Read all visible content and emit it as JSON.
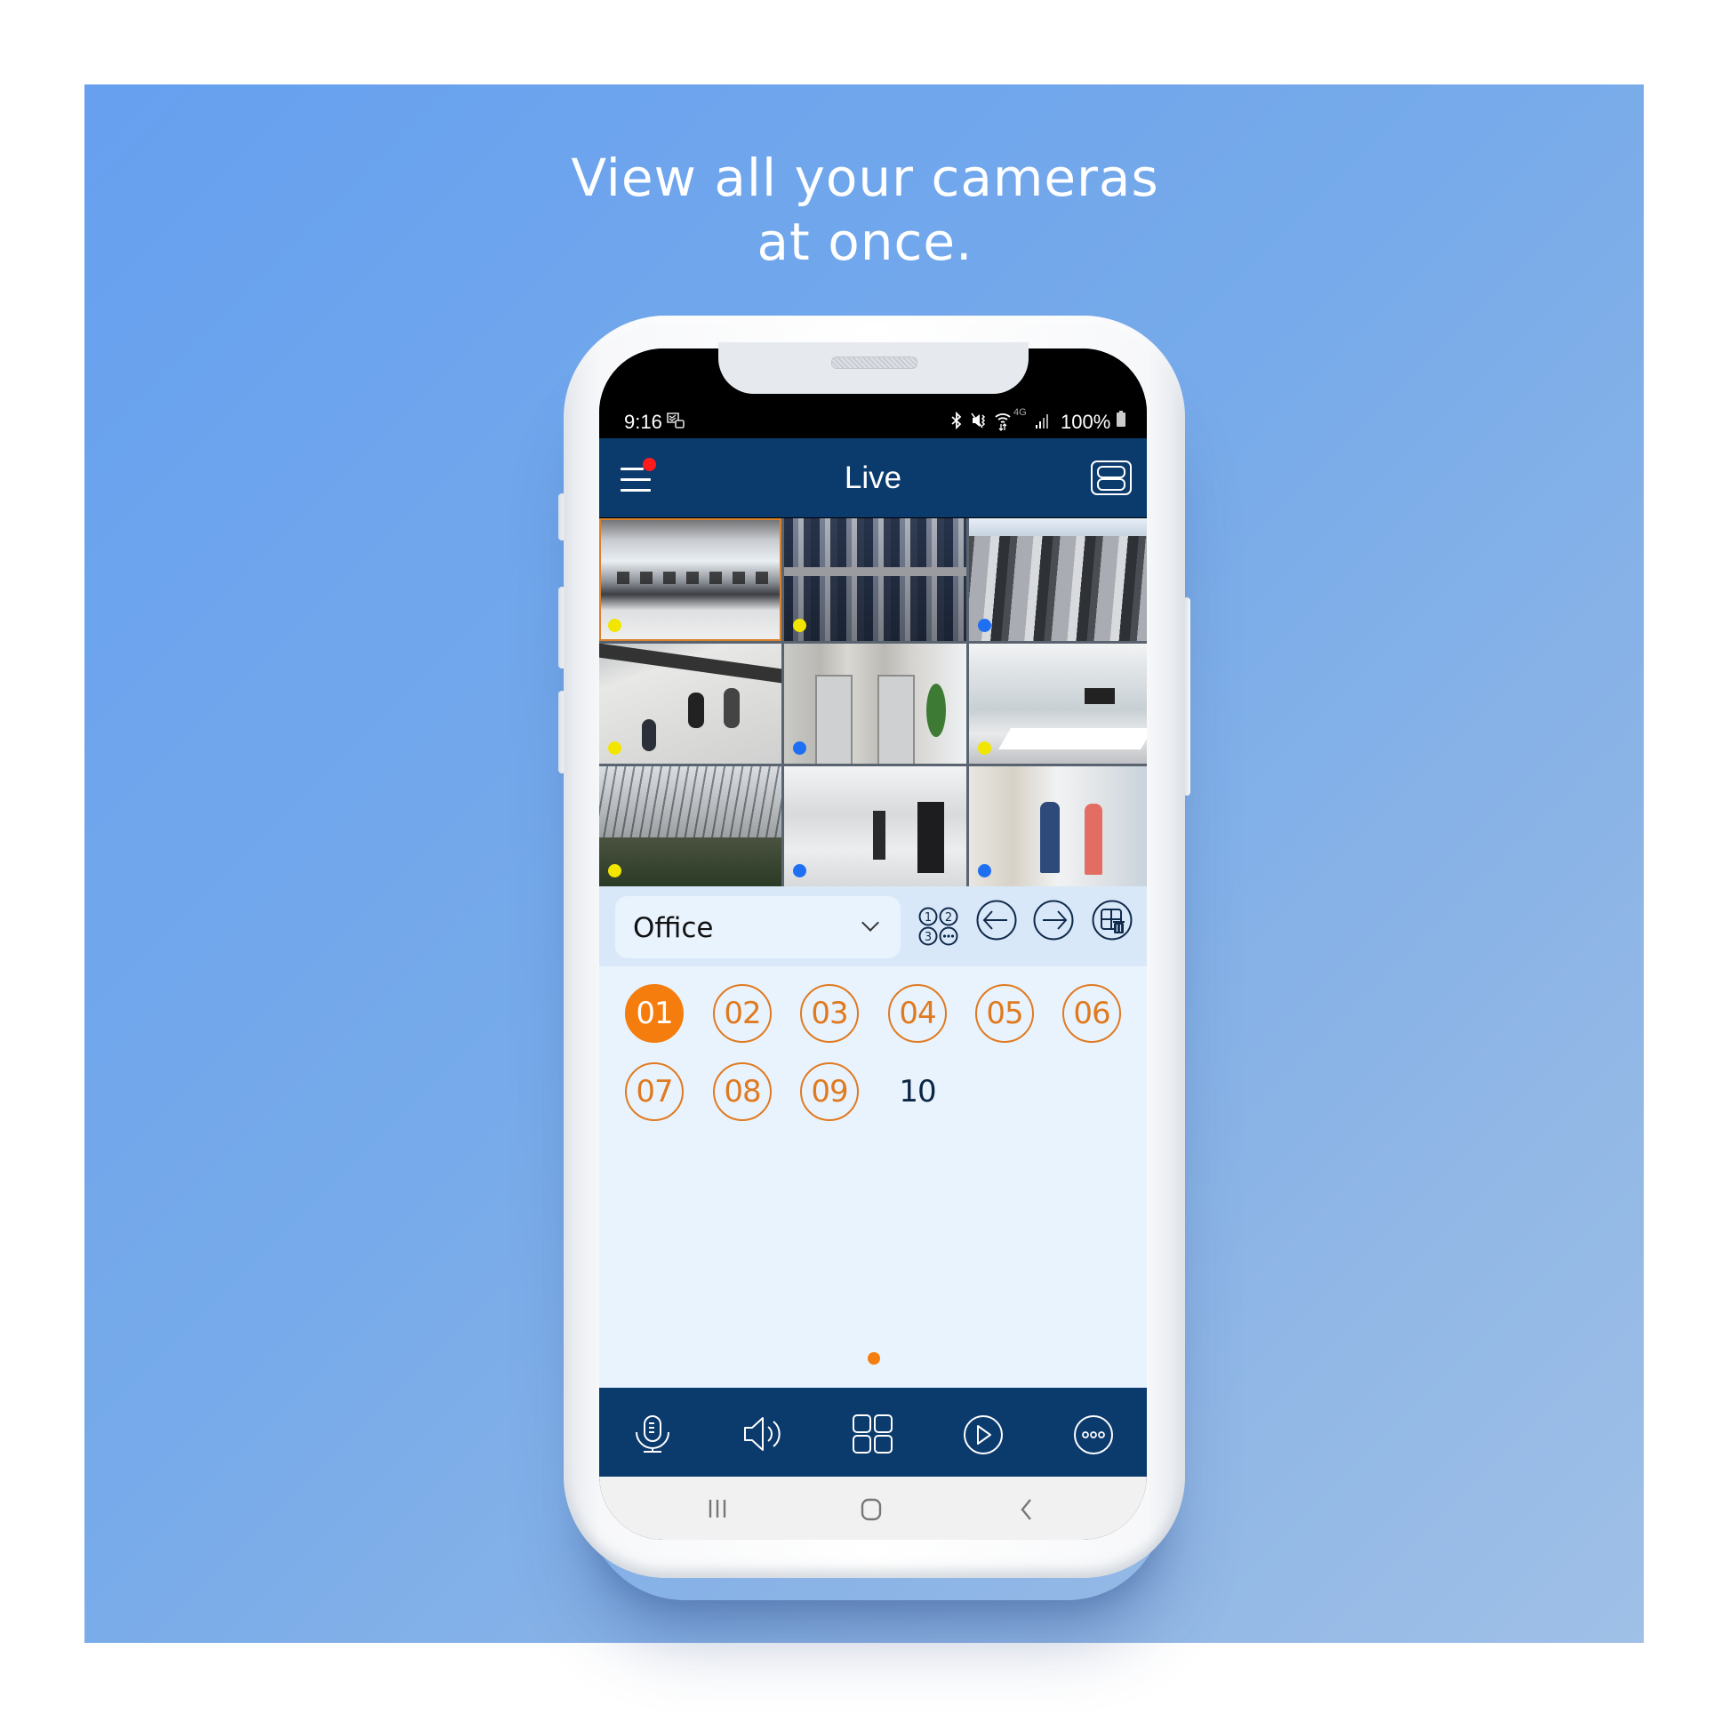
{
  "headline": {
    "line1": "View all your cameras",
    "line2": "at once."
  },
  "status_bar": {
    "time": "9:16",
    "notification_icon": "screenshot-icon",
    "icons": [
      "bluetooth-icon",
      "vibrate-icon",
      "wifi-icon",
      "4g-icon",
      "signal-icon"
    ],
    "network_label": "4G",
    "battery": "100%"
  },
  "header": {
    "title": "Live",
    "menu_icon": "hamburger-menu-icon",
    "menu_badge_color": "#ff1b1b",
    "right_icon": "device-list-icon"
  },
  "camera_grid": {
    "layout": "3x3",
    "selected_index": 0,
    "cameras": [
      {
        "scene": "open office",
        "status_dot": "yellow"
      },
      {
        "scene": "parking lot",
        "status_dot": "yellow"
      },
      {
        "scene": "escalators",
        "status_dot": "blue"
      },
      {
        "scene": "lobby overhead",
        "status_dot": "yellow"
      },
      {
        "scene": "elevator hall",
        "status_dot": "blue"
      },
      {
        "scene": "conference room",
        "status_dot": "yellow"
      },
      {
        "scene": "atrium",
        "status_dot": "yellow"
      },
      {
        "scene": "hallway",
        "status_dot": "blue"
      },
      {
        "scene": "corridor people",
        "status_dot": "blue"
      }
    ],
    "dot_colors": {
      "yellow": "#f2e600",
      "blue": "#1f6ff2"
    }
  },
  "toolbar": {
    "group_select": {
      "value": "Office"
    },
    "buttons": [
      {
        "name": "channel-number-icon"
      },
      {
        "name": "previous-page-icon"
      },
      {
        "name": "next-page-icon"
      },
      {
        "name": "remove-layout-icon"
      }
    ]
  },
  "channels": {
    "items": [
      {
        "label": "01",
        "state": "active"
      },
      {
        "label": "02",
        "state": "available"
      },
      {
        "label": "03",
        "state": "available"
      },
      {
        "label": "04",
        "state": "available"
      },
      {
        "label": "05",
        "state": "available"
      },
      {
        "label": "06",
        "state": "available"
      },
      {
        "label": "07",
        "state": "available"
      },
      {
        "label": "08",
        "state": "available"
      },
      {
        "label": "09",
        "state": "available"
      },
      {
        "label": "10",
        "state": "unavailable"
      }
    ],
    "accent_color": "#f47d0e"
  },
  "pager": {
    "current": 1,
    "total": 1
  },
  "bottom_bar": {
    "items": [
      {
        "name": "microphone-icon"
      },
      {
        "name": "speaker-icon"
      },
      {
        "name": "layout-grid-icon"
      },
      {
        "name": "playback-icon"
      },
      {
        "name": "more-icon"
      }
    ]
  },
  "android_nav": {
    "items": [
      {
        "name": "recent-apps-icon"
      },
      {
        "name": "home-icon"
      },
      {
        "name": "back-icon"
      }
    ]
  },
  "colors": {
    "header_bg": "#0b3a6d",
    "content_bg": "#e9f3fd",
    "toolbar_bg": "#d9e8f8"
  }
}
